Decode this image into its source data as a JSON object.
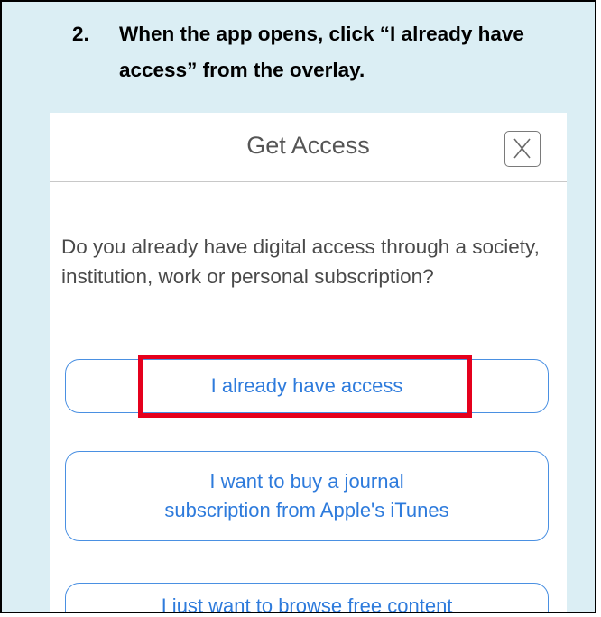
{
  "instruction": {
    "number": "2.",
    "text_line1": "When the app opens, click “I already have",
    "text_line2": "access” from the overlay."
  },
  "dialog": {
    "title": "Get Access",
    "close_icon": "close-x-icon",
    "question": "Do you already have digital access through a society, institution, work or personal subscription?",
    "buttons": {
      "have_access": "I already have access",
      "buy_line1": "I want to buy a journal",
      "buy_line2": "subscription from Apple's iTunes",
      "browse_free": "I just want to browse free content"
    }
  },
  "colors": {
    "background": "#dbeef4",
    "button_border": "#4a90e2",
    "button_text": "#2e7bdc",
    "highlight": "#e5001c"
  }
}
